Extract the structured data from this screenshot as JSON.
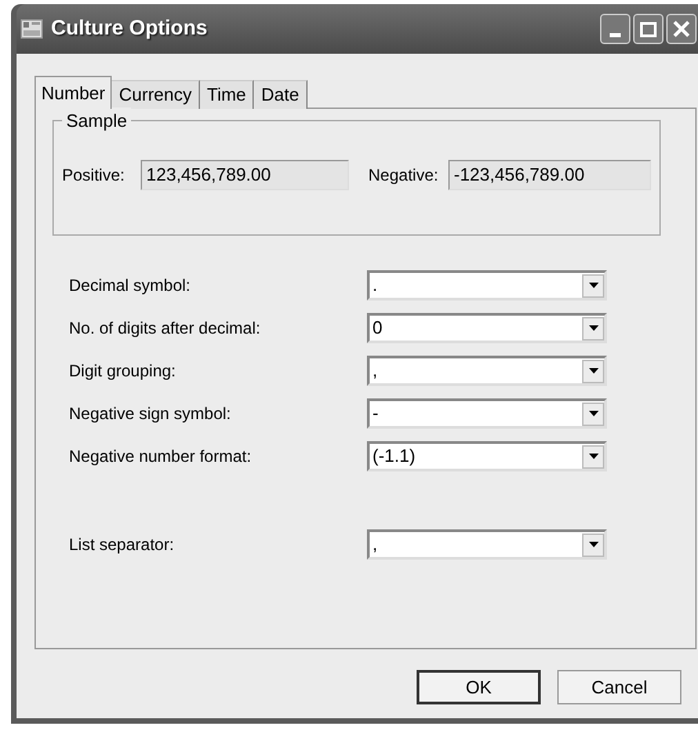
{
  "window": {
    "title": "Culture Options"
  },
  "tabs": [
    {
      "label": "Number",
      "selected": true
    },
    {
      "label": "Currency",
      "selected": false
    },
    {
      "label": "Time",
      "selected": false
    },
    {
      "label": "Date",
      "selected": false
    }
  ],
  "sample": {
    "title": "Sample",
    "positive_label": "Positive:",
    "positive_value": "123,456,789.00",
    "negative_label": "Negative:",
    "negative_value": "-123,456,789.00"
  },
  "fields": [
    {
      "label": "Decimal symbol:",
      "value": "."
    },
    {
      "label": "No. of digits after decimal:",
      "value": "0"
    },
    {
      "label": "Digit grouping:",
      "value": ","
    },
    {
      "label": "Negative sign symbol:",
      "value": "-"
    },
    {
      "label": "Negative number format:",
      "value": "(-1.1)"
    }
  ],
  "list_separator": {
    "label": "List separator:",
    "value": ","
  },
  "buttons": [
    "OK",
    "Cancel"
  ]
}
